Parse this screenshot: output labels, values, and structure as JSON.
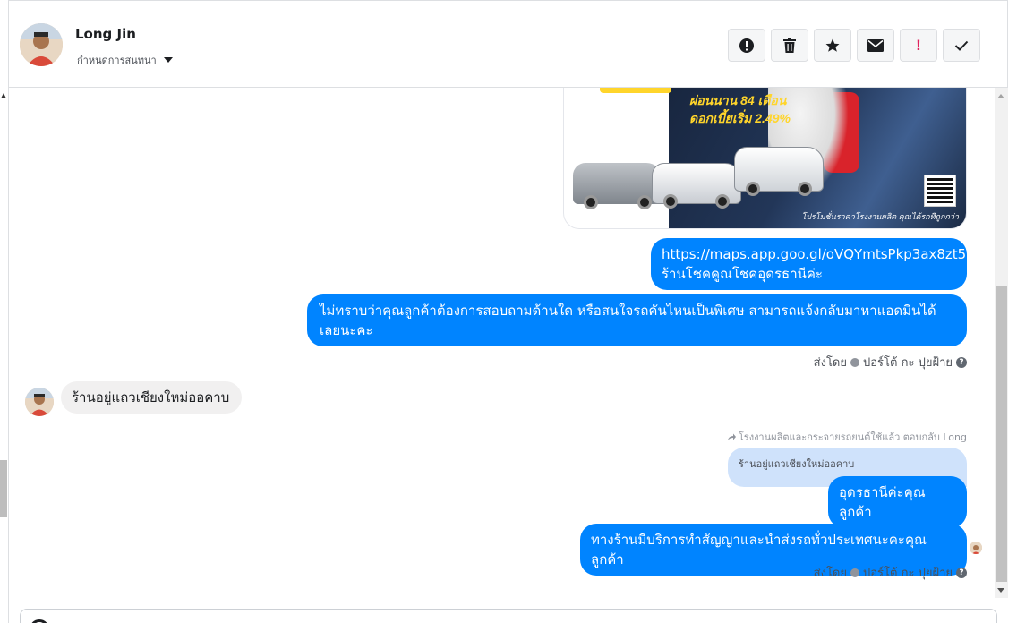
{
  "header": {
    "contact_name": "Long Jin",
    "assign_label": "กำหนดการสนทนา",
    "actions": [
      {
        "name": "spam-button",
        "icon": "alert-circle-icon"
      },
      {
        "name": "delete-button",
        "icon": "trash-icon"
      },
      {
        "name": "star-button",
        "icon": "star-icon"
      },
      {
        "name": "mark-unread-button",
        "icon": "envelope-icon"
      },
      {
        "name": "important-button",
        "icon": "exclamation-icon",
        "text": "!"
      },
      {
        "name": "done-button",
        "icon": "checkmark-icon"
      }
    ]
  },
  "attachment": {
    "headline_1": "ผ่อนนาน 84 เดือน",
    "headline_2": "ดอกเบี้ยเริ่ม 2.49%",
    "footer": "โปรโมชั่นราคาโรงงานผลิต คุณได้รถที่ถูกกว่า"
  },
  "messages": [
    {
      "id": "m1",
      "direction": "out",
      "link": "https://maps.app.goo.gl/oVQYmtsPkp3ax8zt5",
      "text": "ร้านโชคคูณโชคอุดรธานีค่ะ"
    },
    {
      "id": "m2",
      "direction": "out",
      "text": "ไม่ทราบว่าคุณลูกค้าต้องการสอบถามด้านใด หรือสนใจรถคันไหนเป็นพิเศษ สามารถแจ้งกลับมาหาแอดมินได้เลยนะคะ"
    },
    {
      "id": "m3",
      "direction": "in",
      "text": "ร้านอยู่แถวเชียงใหม่ออคาบ"
    },
    {
      "id": "m4",
      "direction": "out",
      "text": "อุดรธานีค่ะคุณลูกค้า"
    },
    {
      "id": "m5",
      "direction": "out",
      "text": "ทางร้านมีบริการทำสัญญาและนำส่งรถทั่วประเทศนะคะคุณลูกค้า"
    }
  ],
  "sent_by": {
    "prefix": "ส่งโดย",
    "agent": "ปอร์โต้ กะ ปุยฝ้าย",
    "help": "?"
  },
  "reply": {
    "meta": "โรงงานผลิตและกระจายรถยนต์ใช้แล้ว ตอบกลับ Long",
    "quoted": "ร้านอยู่แถวเชียงใหม่ออคาบ"
  },
  "colors": {
    "outgoing_bubble": "#0084ff",
    "incoming_bubble": "#f1f0f0",
    "quoted_bubble": "#cfe2fb",
    "important_icon": "#e0245e"
  }
}
